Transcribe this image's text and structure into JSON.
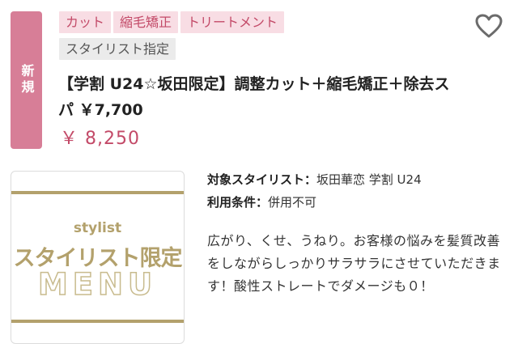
{
  "badge": {
    "new_label": "新規"
  },
  "tags": [
    {
      "label": "カット",
      "style": "pink"
    },
    {
      "label": "縮毛矯正",
      "style": "pink"
    },
    {
      "label": "トリートメント",
      "style": "pink"
    },
    {
      "label": "スタイリスト指定",
      "style": "gray"
    }
  ],
  "favorite": {
    "icon": "heart-outline-icon"
  },
  "coupon": {
    "title": "【学割 U24☆坂田限定】調整カット＋縮毛矯正＋除去スパ ￥7,700",
    "price": "￥ 8,250"
  },
  "banner": {
    "small_text": "stylist",
    "main_text": "スタイリスト限定",
    "menu_text": "MENU",
    "accent_color": "#b3a16c"
  },
  "details": {
    "stylist_label": "対象スタイリスト：",
    "stylist_value": "坂田華恋 学割 U24",
    "conditions_label": "利用条件：",
    "conditions_value": "併用不可",
    "description": "広がり、くせ、うねり。お客様の悩みを髪質改善をしながらしっかりサラサラにさせていただきます！酸性ストレートでダメージも０！"
  },
  "colors": {
    "brand_pink": "#d77e97",
    "price_red": "#c34a68",
    "tag_pink_bg": "#f8dde4"
  }
}
